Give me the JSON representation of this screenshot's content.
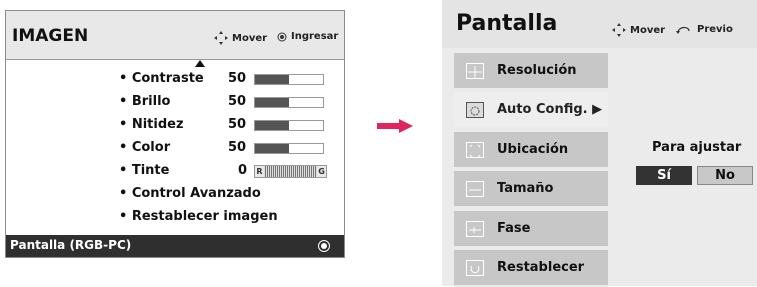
{
  "left_menu": {
    "title": "IMAGEN",
    "hint_move": "Mover",
    "hint_enter": "Ingresar",
    "items": [
      {
        "label": "• Contraste",
        "value": "50",
        "level": 0.5
      },
      {
        "label": "• Brillo",
        "value": "50",
        "level": 0.5
      },
      {
        "label": "• Nitidez",
        "value": "50",
        "level": 0.5
      },
      {
        "label": "• Color",
        "value": "50",
        "level": 0.5
      },
      {
        "label": "• Tinte",
        "value": "0",
        "tint_left": "R",
        "tint_right": "G"
      },
      {
        "label": "• Control Avanzado"
      },
      {
        "label": "• Restablecer imagen"
      }
    ],
    "footer": "Pantalla (RGB-PC)"
  },
  "right_menu": {
    "title": "Pantalla",
    "hint_move": "Mover",
    "hint_prev": "Previo",
    "items": [
      {
        "label": "Resolución",
        "icon": "resolution-icon"
      },
      {
        "label": "Auto Config. ▶",
        "icon": "auto-config-icon",
        "selected": true
      },
      {
        "label": "Ubicación",
        "icon": "position-icon"
      },
      {
        "label": "Tamaño",
        "icon": "size-icon"
      },
      {
        "label": "Fase",
        "icon": "phase-icon"
      },
      {
        "label": "Restablecer",
        "icon": "reset-icon"
      }
    ],
    "adjust_prompt": "Para ajustar",
    "yes": "Sí",
    "no": "No"
  }
}
